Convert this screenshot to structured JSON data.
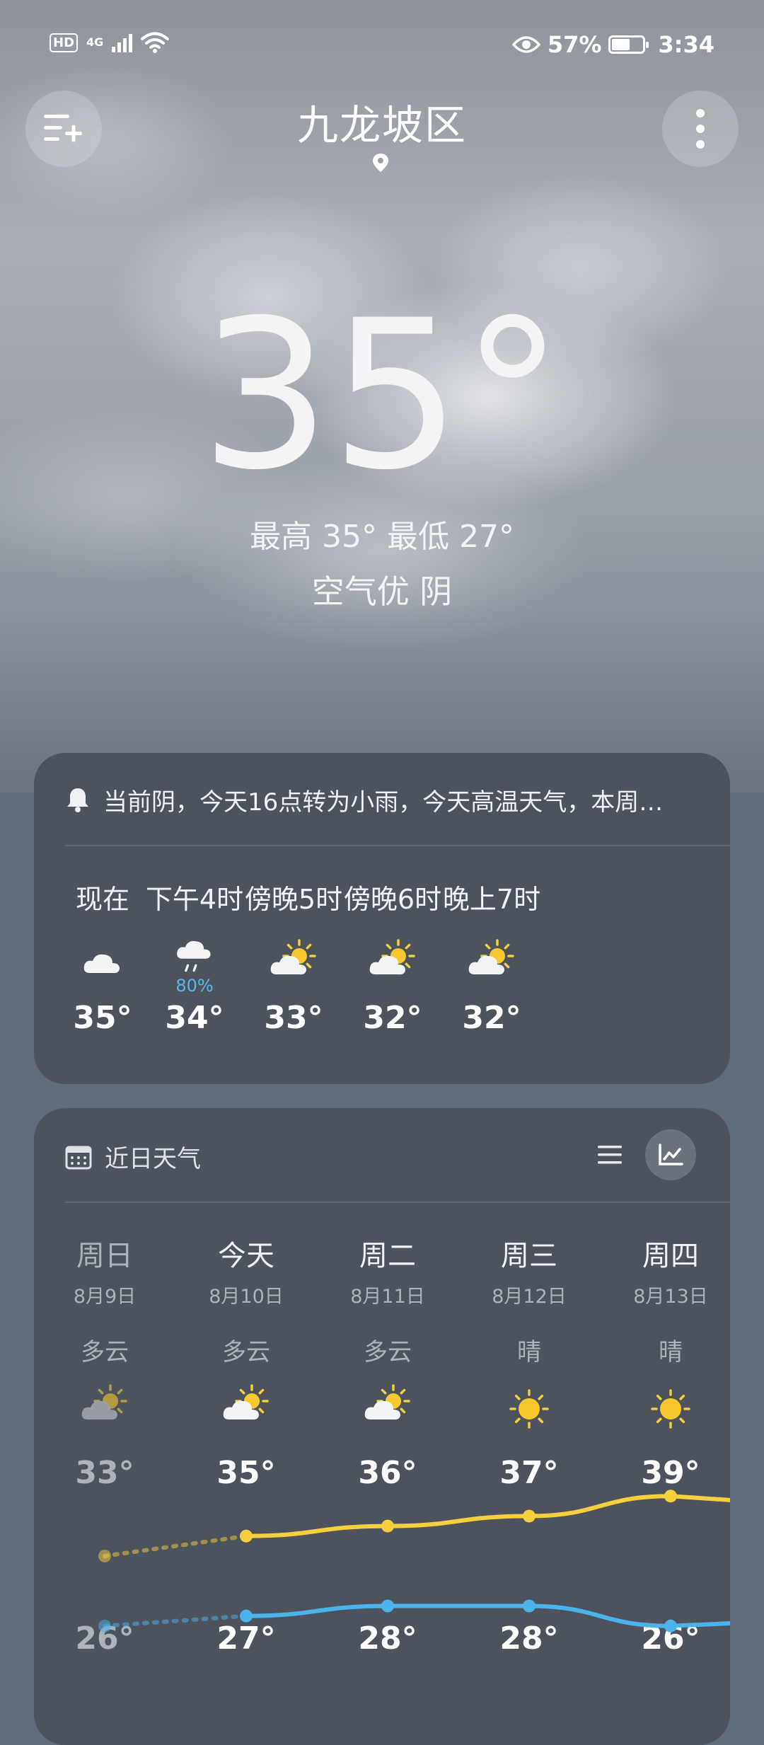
{
  "status_bar": {
    "hd": "HD",
    "network": "4G",
    "battery_pct": "57%",
    "battery_level": 0.57,
    "time": "3:34"
  },
  "header": {
    "city": "九龙坡区",
    "menu_icon": "add-city-icon",
    "more_icon": "more-vertical-icon"
  },
  "current": {
    "temp": "35°",
    "hi_lo": "最高 35° 最低 27°",
    "air_condition": "空气优  阴"
  },
  "hourly_card": {
    "alert": "当前阴，今天16点转为小雨，今天高温天气，本周…",
    "hours": [
      {
        "label": "现在",
        "icon": "cloudy",
        "precip": "",
        "temp": "35°"
      },
      {
        "label": "下午4时",
        "icon": "rain",
        "precip": "80%",
        "temp": "34°"
      },
      {
        "label": "傍晚5时",
        "icon": "partly-cloudy",
        "precip": "",
        "temp": "33°"
      },
      {
        "label": "傍晚6时",
        "icon": "partly-cloudy",
        "precip": "",
        "temp": "32°"
      },
      {
        "label": "晚上7时",
        "icon": "partly-cloudy",
        "precip": "",
        "temp": "32°"
      }
    ]
  },
  "daily_card": {
    "title": "近日天气",
    "list_view_icon": "list-icon",
    "chart_view_icon": "line-chart-icon",
    "days": [
      {
        "name": "周日",
        "date": "8月9日",
        "cond": "多云",
        "icon": "partly-cloudy",
        "hi": "33°",
        "lo": "26°",
        "past": true
      },
      {
        "name": "今天",
        "date": "8月10日",
        "cond": "多云",
        "icon": "partly-cloudy",
        "hi": "35°",
        "lo": "27°",
        "past": false
      },
      {
        "name": "周二",
        "date": "8月11日",
        "cond": "多云",
        "icon": "partly-cloudy",
        "hi": "36°",
        "lo": "28°",
        "past": false
      },
      {
        "name": "周三",
        "date": "8月12日",
        "cond": "晴",
        "icon": "sunny",
        "hi": "37°",
        "lo": "28°",
        "past": false
      },
      {
        "name": "周四",
        "date": "8月13日",
        "cond": "晴",
        "icon": "sunny",
        "hi": "39°",
        "lo": "26°",
        "past": false
      }
    ]
  },
  "chart_data": {
    "type": "line",
    "categories": [
      "周日",
      "今天",
      "周二",
      "周三",
      "周四"
    ],
    "series": [
      {
        "values": [
          33,
          35,
          36,
          37,
          39
        ],
        "color": "#f6cf3f"
      },
      {
        "values": [
          26,
          27,
          28,
          28,
          26
        ],
        "color": "#4ab3ec"
      }
    ]
  },
  "colors": {
    "accent_yellow": "#f6cf3f",
    "accent_blue": "#4ab3ec",
    "card_bg": "#4c535d"
  }
}
